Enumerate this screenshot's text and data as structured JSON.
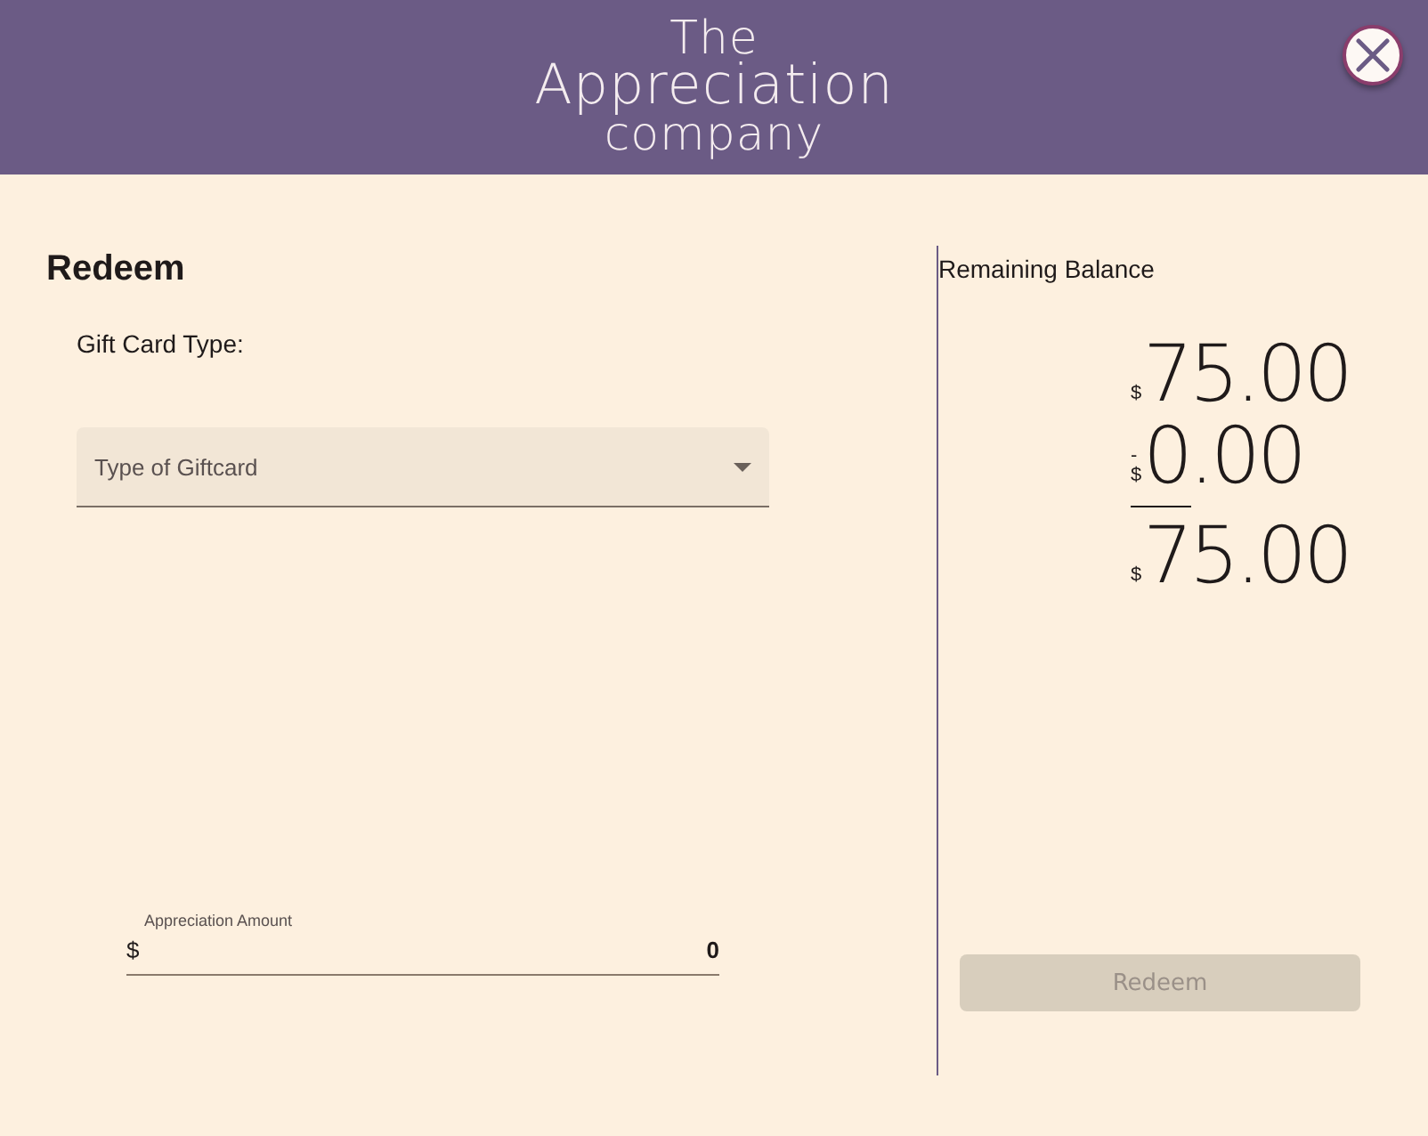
{
  "header": {
    "logo_lines": [
      "The",
      "Appreciation",
      "company"
    ]
  },
  "redeem": {
    "title": "Redeem",
    "gift_card_label": "Gift Card Type:",
    "gift_card_select": {
      "placeholder": "Type of Giftcard"
    },
    "amount_field": {
      "label": "Appreciation Amount",
      "prefix": "$",
      "value": "0"
    }
  },
  "balance": {
    "title": "Remaining Balance",
    "rows": [
      {
        "kind": "amount",
        "sign": "",
        "currency": "$",
        "value": "75.00"
      },
      {
        "kind": "amount",
        "sign": "-",
        "currency": "$",
        "value": "0.00"
      },
      {
        "kind": "rule"
      },
      {
        "kind": "amount",
        "sign": "",
        "currency": "$",
        "value": "75.00"
      }
    ],
    "redeem_button": {
      "label": "Redeem",
      "disabled": true
    }
  }
}
